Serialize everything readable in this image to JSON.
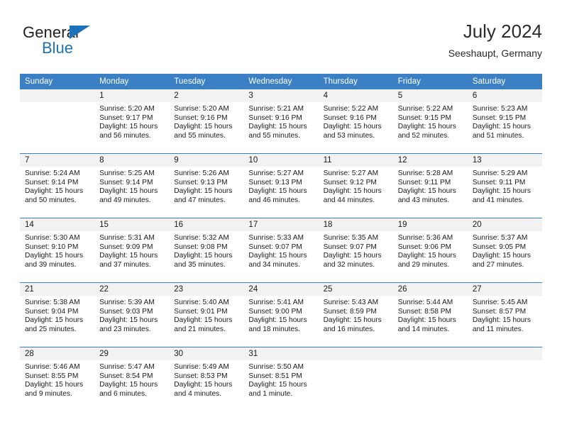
{
  "brand": {
    "name_top": "General",
    "name_bottom": "Blue",
    "accent_color": "#1b72b8",
    "text_color": "#231f20",
    "triangle_icon": "brand-triangle-icon"
  },
  "header": {
    "title": "July 2024",
    "subtitle": "Seeshaupt, Germany"
  },
  "theme": {
    "header_row_bg": "#3b7fc4",
    "header_row_text": "#ffffff",
    "daynum_band_bg": "#f2f2f2",
    "row_divider": "#3b7fc4",
    "body_text": "#1a1a1a"
  },
  "weekday_headers": [
    "Sunday",
    "Monday",
    "Tuesday",
    "Wednesday",
    "Thursday",
    "Friday",
    "Saturday"
  ],
  "weeks": [
    [
      {
        "day": "",
        "blank": true,
        "sunrise": "",
        "sunset": "",
        "daylight_line1": "",
        "daylight_line2": ""
      },
      {
        "day": "1",
        "blank": false,
        "sunrise": "Sunrise: 5:20 AM",
        "sunset": "Sunset: 9:17 PM",
        "daylight_line1": "Daylight: 15 hours",
        "daylight_line2": "and 56 minutes."
      },
      {
        "day": "2",
        "blank": false,
        "sunrise": "Sunrise: 5:20 AM",
        "sunset": "Sunset: 9:16 PM",
        "daylight_line1": "Daylight: 15 hours",
        "daylight_line2": "and 55 minutes."
      },
      {
        "day": "3",
        "blank": false,
        "sunrise": "Sunrise: 5:21 AM",
        "sunset": "Sunset: 9:16 PM",
        "daylight_line1": "Daylight: 15 hours",
        "daylight_line2": "and 55 minutes."
      },
      {
        "day": "4",
        "blank": false,
        "sunrise": "Sunrise: 5:22 AM",
        "sunset": "Sunset: 9:16 PM",
        "daylight_line1": "Daylight: 15 hours",
        "daylight_line2": "and 53 minutes."
      },
      {
        "day": "5",
        "blank": false,
        "sunrise": "Sunrise: 5:22 AM",
        "sunset": "Sunset: 9:15 PM",
        "daylight_line1": "Daylight: 15 hours",
        "daylight_line2": "and 52 minutes."
      },
      {
        "day": "6",
        "blank": false,
        "sunrise": "Sunrise: 5:23 AM",
        "sunset": "Sunset: 9:15 PM",
        "daylight_line1": "Daylight: 15 hours",
        "daylight_line2": "and 51 minutes."
      }
    ],
    [
      {
        "day": "7",
        "blank": false,
        "sunrise": "Sunrise: 5:24 AM",
        "sunset": "Sunset: 9:14 PM",
        "daylight_line1": "Daylight: 15 hours",
        "daylight_line2": "and 50 minutes."
      },
      {
        "day": "8",
        "blank": false,
        "sunrise": "Sunrise: 5:25 AM",
        "sunset": "Sunset: 9:14 PM",
        "daylight_line1": "Daylight: 15 hours",
        "daylight_line2": "and 49 minutes."
      },
      {
        "day": "9",
        "blank": false,
        "sunrise": "Sunrise: 5:26 AM",
        "sunset": "Sunset: 9:13 PM",
        "daylight_line1": "Daylight: 15 hours",
        "daylight_line2": "and 47 minutes."
      },
      {
        "day": "10",
        "blank": false,
        "sunrise": "Sunrise: 5:27 AM",
        "sunset": "Sunset: 9:13 PM",
        "daylight_line1": "Daylight: 15 hours",
        "daylight_line2": "and 46 minutes."
      },
      {
        "day": "11",
        "blank": false,
        "sunrise": "Sunrise: 5:27 AM",
        "sunset": "Sunset: 9:12 PM",
        "daylight_line1": "Daylight: 15 hours",
        "daylight_line2": "and 44 minutes."
      },
      {
        "day": "12",
        "blank": false,
        "sunrise": "Sunrise: 5:28 AM",
        "sunset": "Sunset: 9:11 PM",
        "daylight_line1": "Daylight: 15 hours",
        "daylight_line2": "and 43 minutes."
      },
      {
        "day": "13",
        "blank": false,
        "sunrise": "Sunrise: 5:29 AM",
        "sunset": "Sunset: 9:11 PM",
        "daylight_line1": "Daylight: 15 hours",
        "daylight_line2": "and 41 minutes."
      }
    ],
    [
      {
        "day": "14",
        "blank": false,
        "sunrise": "Sunrise: 5:30 AM",
        "sunset": "Sunset: 9:10 PM",
        "daylight_line1": "Daylight: 15 hours",
        "daylight_line2": "and 39 minutes."
      },
      {
        "day": "15",
        "blank": false,
        "sunrise": "Sunrise: 5:31 AM",
        "sunset": "Sunset: 9:09 PM",
        "daylight_line1": "Daylight: 15 hours",
        "daylight_line2": "and 37 minutes."
      },
      {
        "day": "16",
        "blank": false,
        "sunrise": "Sunrise: 5:32 AM",
        "sunset": "Sunset: 9:08 PM",
        "daylight_line1": "Daylight: 15 hours",
        "daylight_line2": "and 35 minutes."
      },
      {
        "day": "17",
        "blank": false,
        "sunrise": "Sunrise: 5:33 AM",
        "sunset": "Sunset: 9:07 PM",
        "daylight_line1": "Daylight: 15 hours",
        "daylight_line2": "and 34 minutes."
      },
      {
        "day": "18",
        "blank": false,
        "sunrise": "Sunrise: 5:35 AM",
        "sunset": "Sunset: 9:07 PM",
        "daylight_line1": "Daylight: 15 hours",
        "daylight_line2": "and 32 minutes."
      },
      {
        "day": "19",
        "blank": false,
        "sunrise": "Sunrise: 5:36 AM",
        "sunset": "Sunset: 9:06 PM",
        "daylight_line1": "Daylight: 15 hours",
        "daylight_line2": "and 29 minutes."
      },
      {
        "day": "20",
        "blank": false,
        "sunrise": "Sunrise: 5:37 AM",
        "sunset": "Sunset: 9:05 PM",
        "daylight_line1": "Daylight: 15 hours",
        "daylight_line2": "and 27 minutes."
      }
    ],
    [
      {
        "day": "21",
        "blank": false,
        "sunrise": "Sunrise: 5:38 AM",
        "sunset": "Sunset: 9:04 PM",
        "daylight_line1": "Daylight: 15 hours",
        "daylight_line2": "and 25 minutes."
      },
      {
        "day": "22",
        "blank": false,
        "sunrise": "Sunrise: 5:39 AM",
        "sunset": "Sunset: 9:03 PM",
        "daylight_line1": "Daylight: 15 hours",
        "daylight_line2": "and 23 minutes."
      },
      {
        "day": "23",
        "blank": false,
        "sunrise": "Sunrise: 5:40 AM",
        "sunset": "Sunset: 9:01 PM",
        "daylight_line1": "Daylight: 15 hours",
        "daylight_line2": "and 21 minutes."
      },
      {
        "day": "24",
        "blank": false,
        "sunrise": "Sunrise: 5:41 AM",
        "sunset": "Sunset: 9:00 PM",
        "daylight_line1": "Daylight: 15 hours",
        "daylight_line2": "and 18 minutes."
      },
      {
        "day": "25",
        "blank": false,
        "sunrise": "Sunrise: 5:43 AM",
        "sunset": "Sunset: 8:59 PM",
        "daylight_line1": "Daylight: 15 hours",
        "daylight_line2": "and 16 minutes."
      },
      {
        "day": "26",
        "blank": false,
        "sunrise": "Sunrise: 5:44 AM",
        "sunset": "Sunset: 8:58 PM",
        "daylight_line1": "Daylight: 15 hours",
        "daylight_line2": "and 14 minutes."
      },
      {
        "day": "27",
        "blank": false,
        "sunrise": "Sunrise: 5:45 AM",
        "sunset": "Sunset: 8:57 PM",
        "daylight_line1": "Daylight: 15 hours",
        "daylight_line2": "and 11 minutes."
      }
    ],
    [
      {
        "day": "28",
        "blank": false,
        "sunrise": "Sunrise: 5:46 AM",
        "sunset": "Sunset: 8:55 PM",
        "daylight_line1": "Daylight: 15 hours",
        "daylight_line2": "and 9 minutes."
      },
      {
        "day": "29",
        "blank": false,
        "sunrise": "Sunrise: 5:47 AM",
        "sunset": "Sunset: 8:54 PM",
        "daylight_line1": "Daylight: 15 hours",
        "daylight_line2": "and 6 minutes."
      },
      {
        "day": "30",
        "blank": false,
        "sunrise": "Sunrise: 5:49 AM",
        "sunset": "Sunset: 8:53 PM",
        "daylight_line1": "Daylight: 15 hours",
        "daylight_line2": "and 4 minutes."
      },
      {
        "day": "31",
        "blank": false,
        "sunrise": "Sunrise: 5:50 AM",
        "sunset": "Sunset: 8:51 PM",
        "daylight_line1": "Daylight: 15 hours",
        "daylight_line2": "and 1 minute."
      },
      {
        "day": "",
        "blank": true,
        "sunrise": "",
        "sunset": "",
        "daylight_line1": "",
        "daylight_line2": ""
      },
      {
        "day": "",
        "blank": true,
        "sunrise": "",
        "sunset": "",
        "daylight_line1": "",
        "daylight_line2": ""
      },
      {
        "day": "",
        "blank": true,
        "sunrise": "",
        "sunset": "",
        "daylight_line1": "",
        "daylight_line2": ""
      }
    ]
  ]
}
